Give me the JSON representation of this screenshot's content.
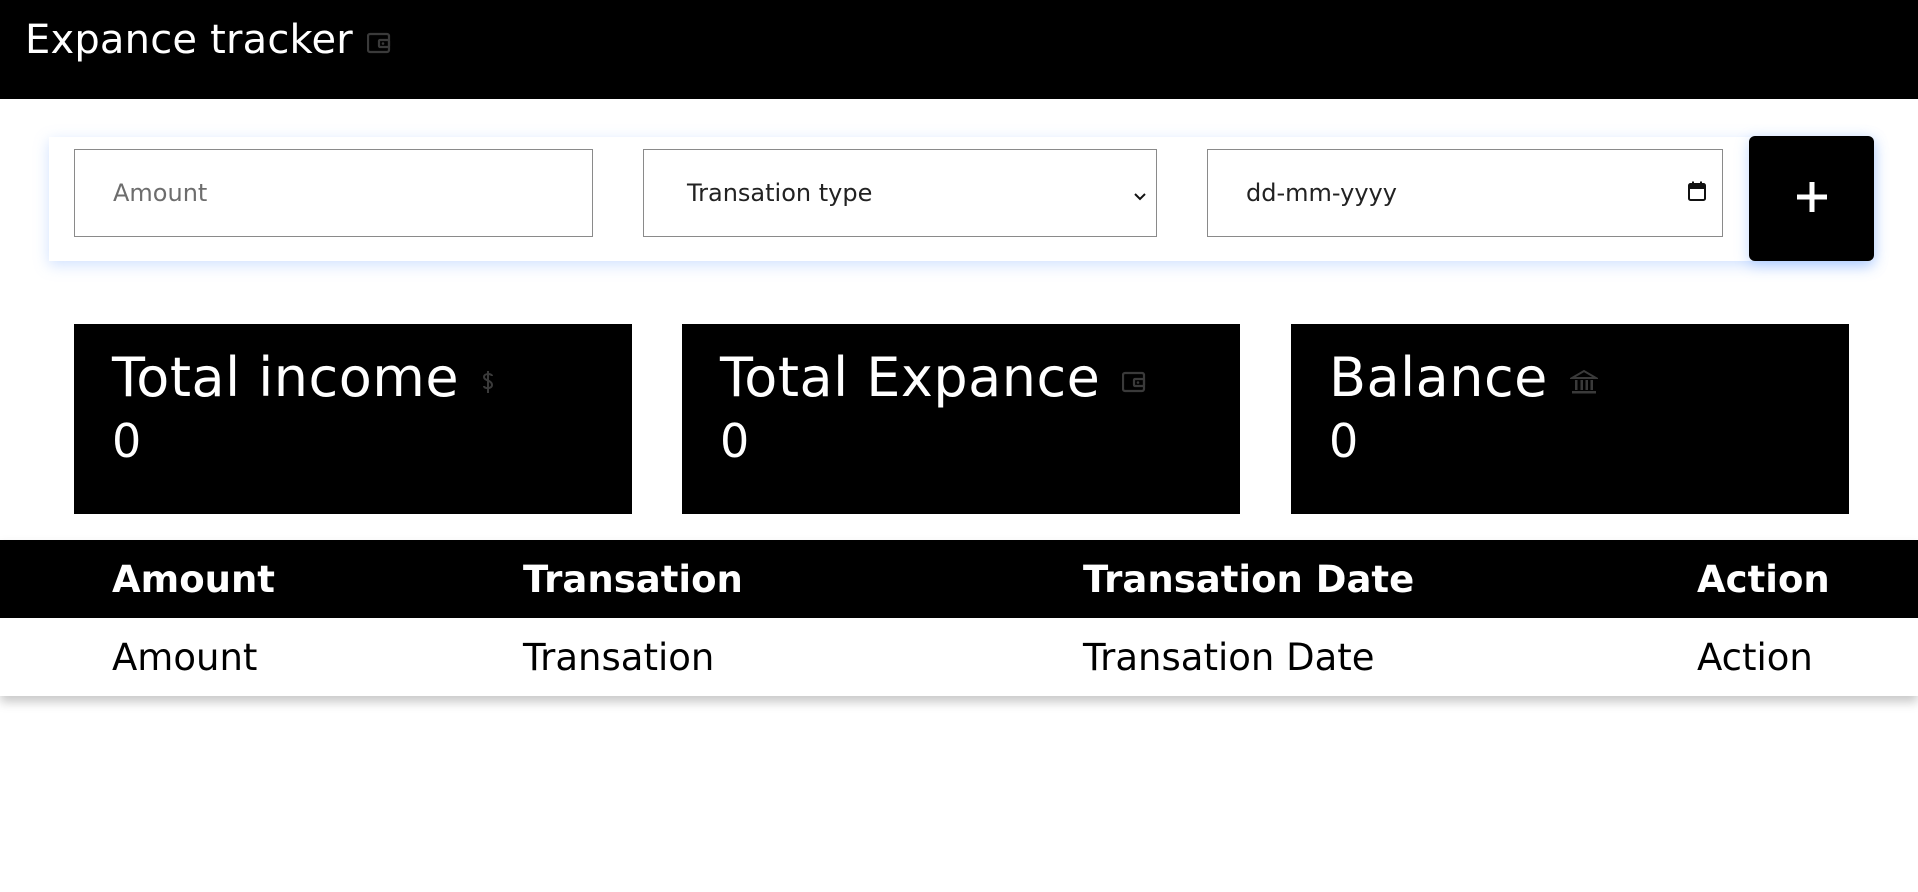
{
  "header": {
    "title": "Expance tracker",
    "title_icon": "wallet-icon"
  },
  "form": {
    "amount_placeholder": "Amount",
    "transaction_type_selected": "Transation type",
    "date_placeholder": "dd-mm-yyyy",
    "add_label": "+"
  },
  "stats": [
    {
      "title": "Total income",
      "value": "0",
      "icon": "dollar-icon"
    },
    {
      "title": "Total Expance",
      "value": "0",
      "icon": "wallet-icon"
    },
    {
      "title": "Balance",
      "value": "0",
      "icon": "bank-icon"
    }
  ],
  "table": {
    "headers": [
      "Amount",
      "Transation",
      "Transation Date",
      "Action"
    ],
    "rows": [
      [
        "Amount",
        "Transation",
        "Transation Date",
        "Action"
      ]
    ]
  },
  "colors": {
    "primary": "#000000",
    "background": "#ffffff",
    "card_glow": "#78aaff"
  }
}
